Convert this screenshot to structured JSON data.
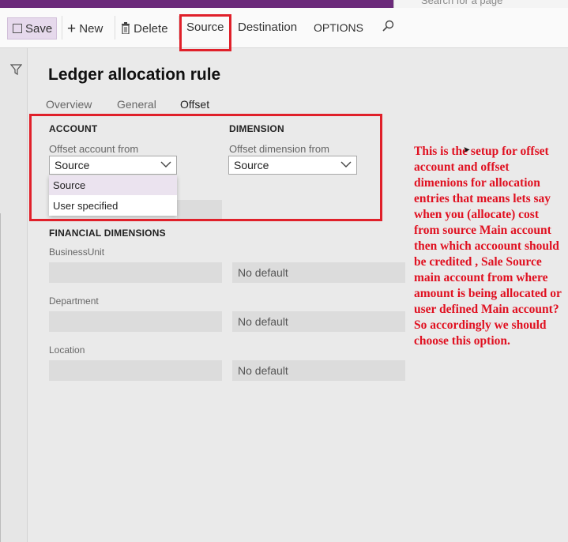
{
  "search": {
    "placeholder": "Search for a page"
  },
  "toolbar": {
    "save": "Save",
    "new": "New",
    "delete": "Delete",
    "source": "Source",
    "destination": "Destination",
    "options": "OPTIONS"
  },
  "form": {
    "title": "Ledger allocation rule",
    "tabs": [
      "Overview",
      "General",
      "Offset"
    ],
    "account": {
      "header": "ACCOUNT",
      "label": "Offset account from",
      "value": "Source",
      "options": [
        "Source",
        "User specified"
      ]
    },
    "dimension": {
      "header": "DIMENSION",
      "label": "Offset dimension from",
      "value": "Source"
    },
    "financial": {
      "header": "FINANCIAL DIMENSIONS",
      "rows": [
        {
          "label": "BusinessUnit",
          "value": "No default"
        },
        {
          "label": "Department",
          "value": "No default"
        },
        {
          "label": "Location",
          "value": "No default"
        }
      ]
    }
  },
  "annotation": {
    "text": "This is the setup for offset account and offset dimenions for allocation entries that means lets say when you (allocate) cost from source Main account then which accoount should be credited , Sale Source main account from where amount is being allocated or user defined Main account? So accordingly we should choose this option.",
    "color": "#e01020"
  },
  "colors": {
    "highlight": "#e0202a",
    "brand": "#6b2a7a"
  }
}
